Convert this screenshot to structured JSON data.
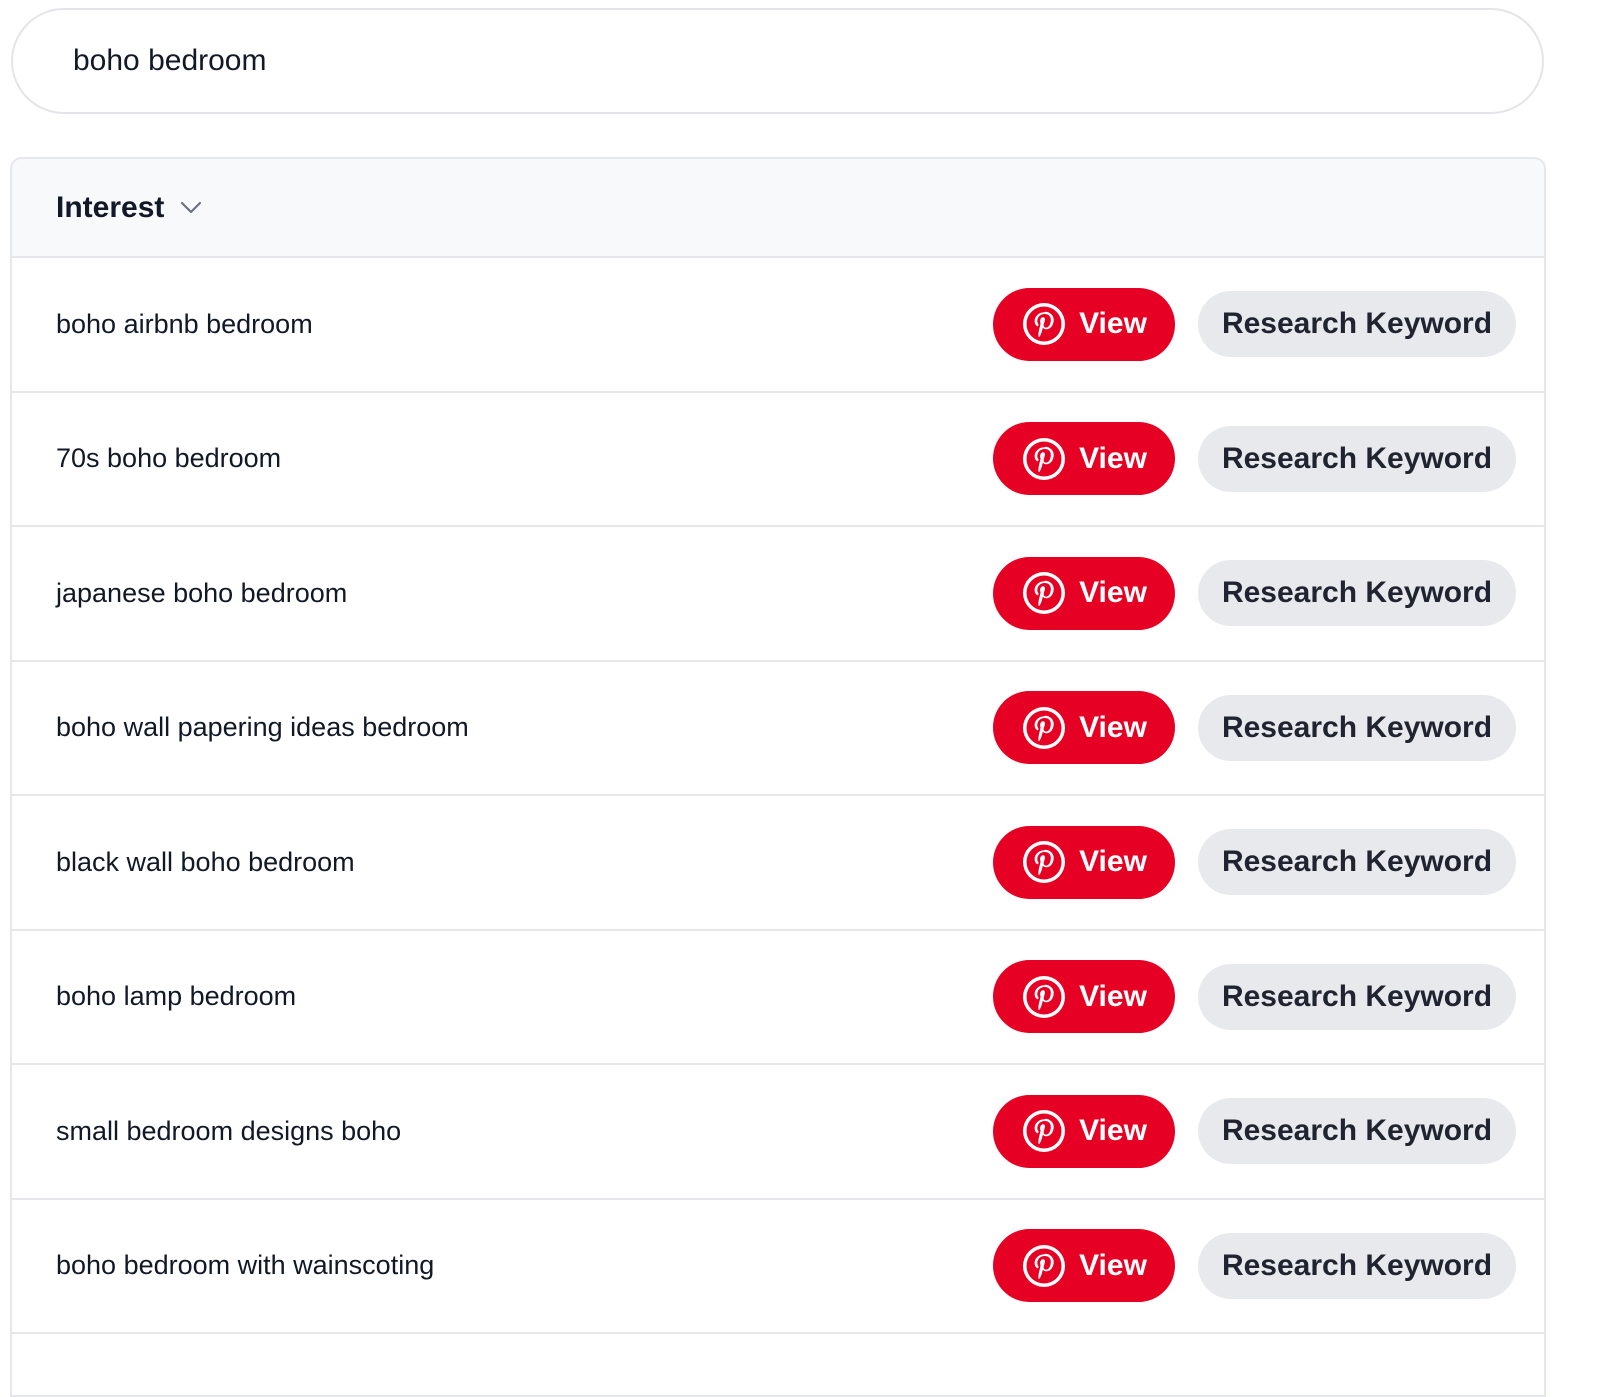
{
  "search": {
    "value": "boho bedroom",
    "icon": "none"
  },
  "table": {
    "column_header": "Interest",
    "column_header_icon": "chevron-down-icon",
    "view_label": "View",
    "view_icon": "pinterest-icon",
    "research_label": "Research Keyword",
    "colors": {
      "view_button": "#e60023",
      "research_button": "#e8e9ec",
      "header_background": "#f8f9fa"
    },
    "rows": [
      {
        "keyword": "boho airbnb bedroom"
      },
      {
        "keyword": "70s boho bedroom"
      },
      {
        "keyword": "japanese boho bedroom"
      },
      {
        "keyword": "boho wall papering ideas bedroom"
      },
      {
        "keyword": "black wall boho bedroom"
      },
      {
        "keyword": "boho lamp bedroom"
      },
      {
        "keyword": "small bedroom designs boho"
      },
      {
        "keyword": "boho bedroom with wainscoting"
      }
    ]
  }
}
